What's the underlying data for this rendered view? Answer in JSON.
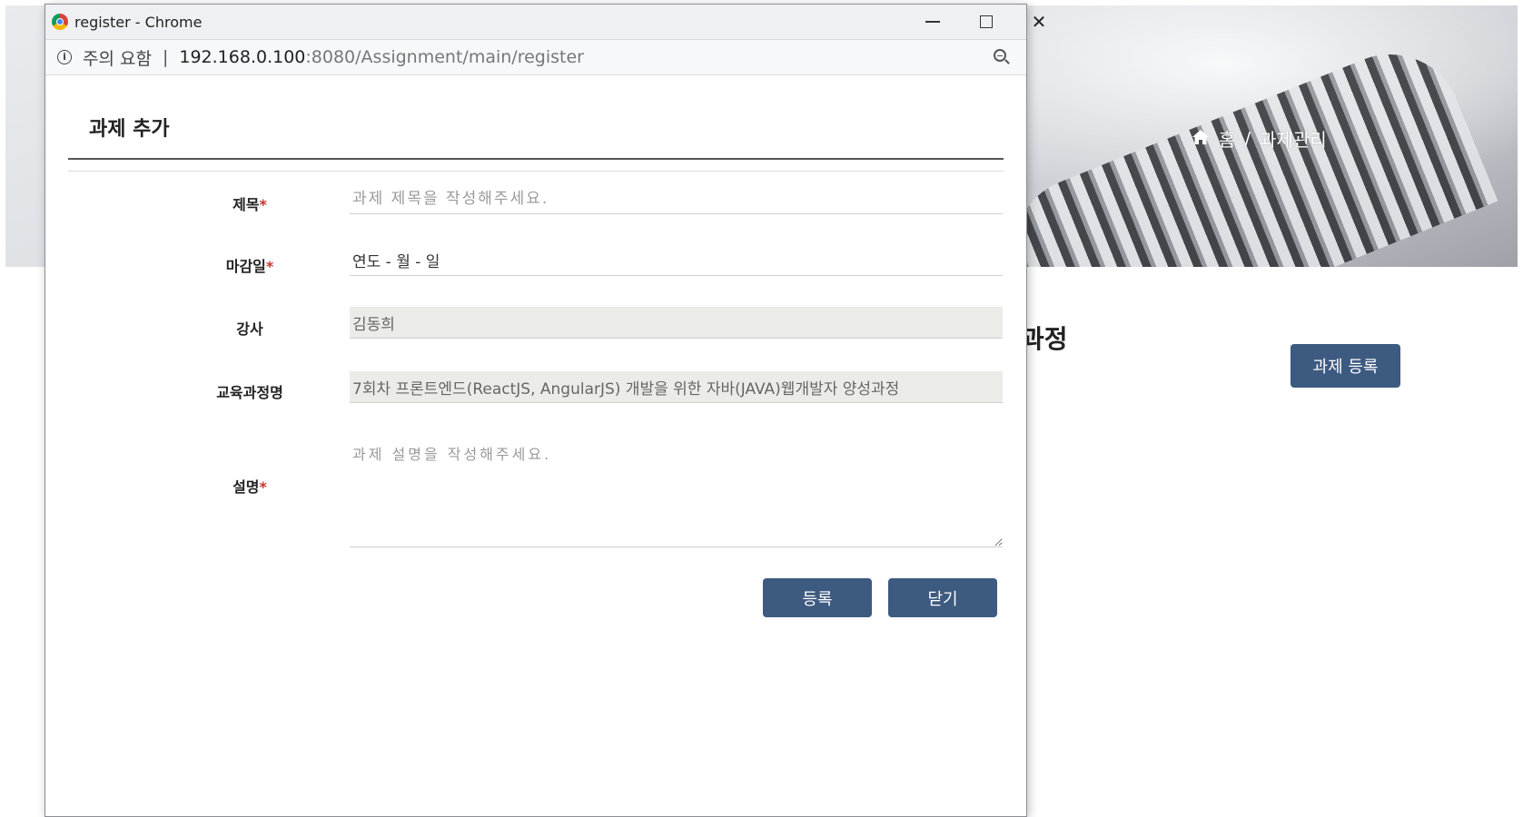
{
  "background": {
    "breadcrumb": {
      "home_icon": "home-icon",
      "home_label": "홈",
      "separator": "/",
      "current": "과제관리"
    },
    "heading_fragment": "과정",
    "register_button": "과제 등록"
  },
  "window": {
    "title": "register - Chrome",
    "controls": {
      "minimize": "minimize-icon",
      "maximize": "maximize-icon",
      "close": "✕"
    },
    "address_bar": {
      "security_icon": "info-icon",
      "security_warning": "주의 요함",
      "separator": "|",
      "url_host": "192.168.0.100",
      "url_path": ":8080/Assignment/main/register",
      "zoom_icon": "zoom-out-icon"
    }
  },
  "form": {
    "title": "과제 추가",
    "required_mark": "*",
    "fields": {
      "title": {
        "label": "제목",
        "placeholder": "과제 제목을 작성해주세요."
      },
      "deadline": {
        "label": "마감일",
        "value": "연도 - 월 - 일"
      },
      "instructor": {
        "label": "강사",
        "value": "김동희"
      },
      "course": {
        "label": "교육과정명",
        "value": "7회차 프론트엔드(ReactJS, AngularJS) 개발을 위한 자바(JAVA)웹개발자 양성과정"
      },
      "description": {
        "label": "설명",
        "placeholder": "과제 설명을 작성해주세요."
      }
    },
    "buttons": {
      "submit": "등록",
      "close": "닫기"
    }
  },
  "colors": {
    "primary_button": "#3d5a80",
    "required_mark": "#c0392b",
    "readonly_background": "#ebebe8"
  }
}
